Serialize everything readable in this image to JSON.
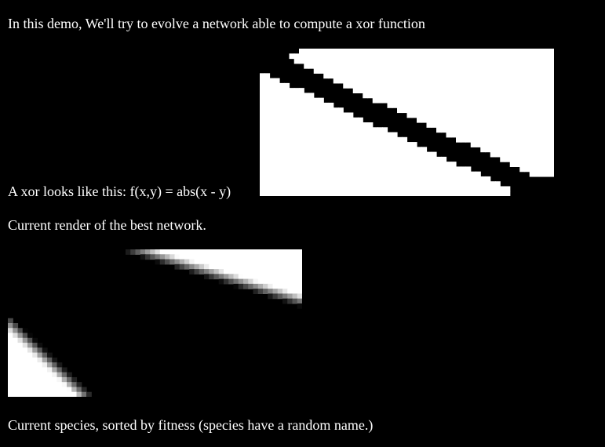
{
  "page": {
    "intro_text": "In this demo, We'll try to evolve a network able to compute a xor function",
    "xor_label": "A xor looks like this: f(x,y) = abs(x - y)",
    "render_label": "Current render of the best network.",
    "species_label": "Current species, sorted by fitness (species have a random name.)"
  },
  "colors": {
    "background": "#000000",
    "text": "#ffffff",
    "high": "#ffffff",
    "low": "#000000"
  },
  "xor_render": {
    "function": "abs(x - y)",
    "grid_cols": 60,
    "grid_rows": 30
  },
  "network_render": {
    "grid_cols": 60,
    "grid_rows": 30
  }
}
